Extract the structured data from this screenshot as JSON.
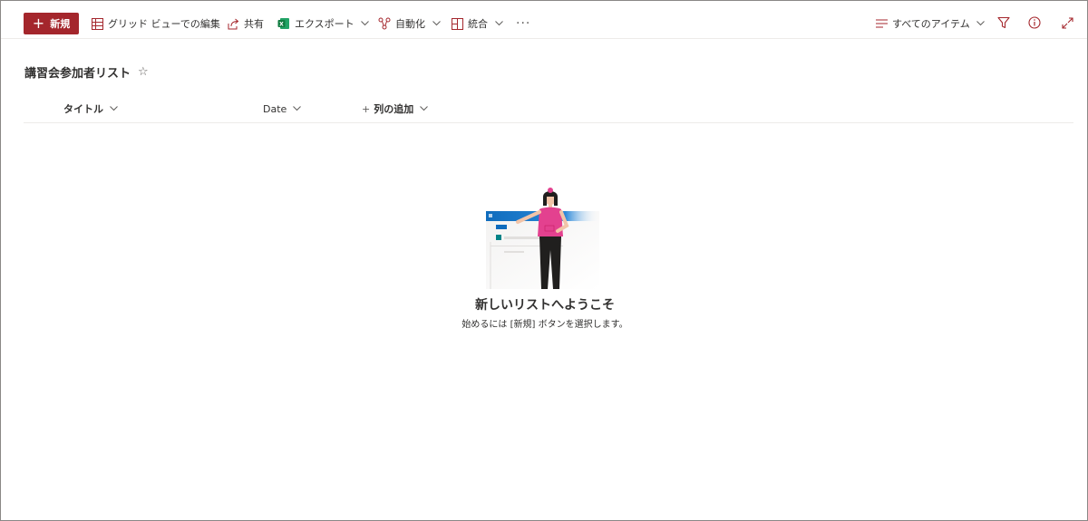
{
  "toolbar": {
    "new_label": "新規",
    "grid_edit_label": "グリッド ビューでの編集",
    "share_label": "共有",
    "export_label": "エクスポート",
    "automate_label": "自動化",
    "integrate_label": "統合",
    "more_label": "···",
    "view_label": "すべてのアイテム"
  },
  "list": {
    "title": "講習会参加者リスト",
    "columns": [
      {
        "label": "タイトル"
      },
      {
        "label": "Date"
      },
      {
        "label": "列の追加"
      }
    ]
  },
  "empty_state": {
    "title": "新しいリストへようこそ",
    "subtitle": "始めるには [新規] ボタンを選択します。"
  },
  "colors": {
    "accent": "#a4262c",
    "excel_green": "#107c41",
    "illustration_blue": "#0f6cbd",
    "illustration_pink": "#e3418f"
  }
}
